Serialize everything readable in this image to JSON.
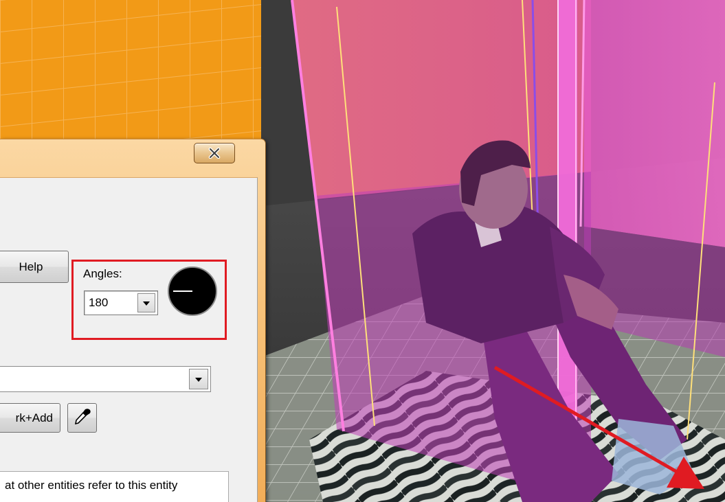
{
  "dialog": {
    "close_icon": "close-icon",
    "help_label": "Help",
    "angles": {
      "label": "Angles:",
      "value": "180",
      "dial_icon": "angle-dial-icon"
    },
    "class_combo_value": "",
    "mark_add_label": "rk+Add",
    "picker_icon": "eyedropper-icon",
    "help_text": "at other entities refer to this entity"
  },
  "colors": {
    "highlight_box": "#e01b22",
    "direction_arrow": "#e01b22",
    "wall_orange": "#f39b16",
    "trigger_volume_pink": "#f04fb5"
  }
}
